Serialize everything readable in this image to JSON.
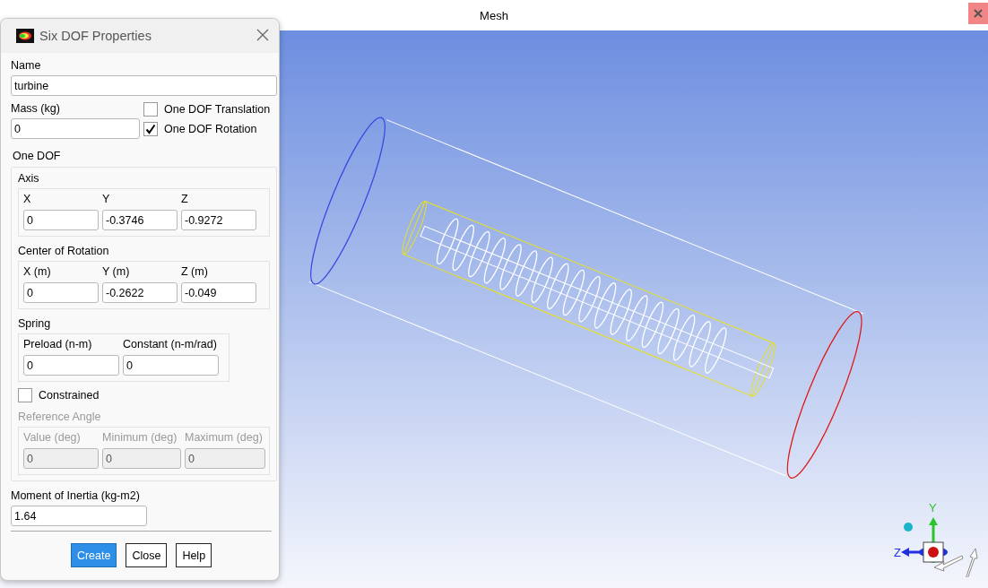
{
  "window": {
    "title": "Mesh"
  },
  "dialog": {
    "title": "Six DOF Properties",
    "name": {
      "label": "Name",
      "value": "turbine"
    },
    "mass": {
      "label": "Mass (kg)",
      "value": "0"
    },
    "options": [
      {
        "label": "One DOF Translation",
        "checked": false
      },
      {
        "label": "One DOF Rotation",
        "checked": true
      }
    ],
    "one_dof": {
      "label": "One DOF",
      "groups": [
        {
          "label": "Axis",
          "fields": [
            {
              "label": "X",
              "value": "0"
            },
            {
              "label": "Y",
              "value": "-0.3746"
            },
            {
              "label": "Z",
              "value": "-0.9272"
            }
          ]
        },
        {
          "label": "Center of Rotation",
          "fields": [
            {
              "label": "X (m)",
              "value": "0"
            },
            {
              "label": "Y (m)",
              "value": "-0.2622"
            },
            {
              "label": "Z (m)",
              "value": "-0.049"
            }
          ]
        },
        {
          "label": "Spring",
          "fields": [
            {
              "label": "Preload (n-m)",
              "value": "0"
            },
            {
              "label": "Constant (n-m/rad)",
              "value": "0"
            }
          ]
        }
      ],
      "constrained": {
        "label": "Constrained",
        "checked": false
      },
      "reference_angle": {
        "label": "Reference Angle",
        "disabled": true,
        "fields": [
          {
            "label": "Value (deg)",
            "value": "0"
          },
          {
            "label": "Minimum (deg)",
            "value": "0"
          },
          {
            "label": "Maximum (deg)",
            "value": "0"
          }
        ]
      }
    },
    "inertia": {
      "label": "Moment of Inertia (kg-m2)",
      "value": "1.64"
    },
    "buttons": [
      {
        "label": "Create",
        "kind": "primary"
      },
      {
        "label": "Close",
        "kind": "normal"
      },
      {
        "label": "Help",
        "kind": "normal"
      }
    ]
  },
  "triad": {
    "y_label": "Y",
    "z_label": "Z"
  }
}
